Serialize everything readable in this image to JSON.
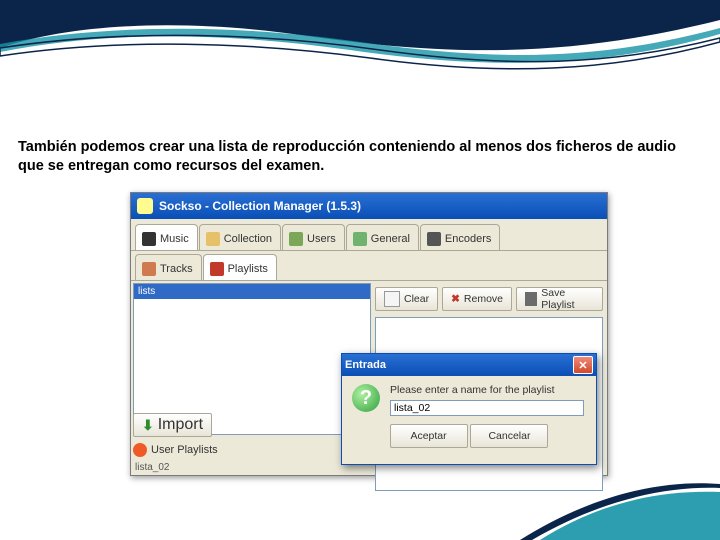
{
  "description": "También podemos crear una lista de reproducción conteniendo al menos dos ficheros de audio que se entregan como recursos del examen.",
  "window": {
    "title": "Sockso - Collection Manager (1.5.3)"
  },
  "tabs": {
    "main": [
      "Music",
      "Collection",
      "Users",
      "General",
      "Encoders"
    ],
    "sub": [
      "Tracks",
      "Playlists"
    ]
  },
  "leftpane": {
    "header": "lists"
  },
  "toolbar": {
    "clear": "Clear",
    "remove": "Remove",
    "save": "Save Playlist"
  },
  "leftactions": {
    "import": "Import",
    "user_playlists": "User Playlists",
    "playlist_name": "lista_02"
  },
  "dialog": {
    "title": "Entrada",
    "message": "Please enter a name for the playlist",
    "value": "lista_02",
    "accept": "Aceptar",
    "cancel": "Cancelar"
  }
}
